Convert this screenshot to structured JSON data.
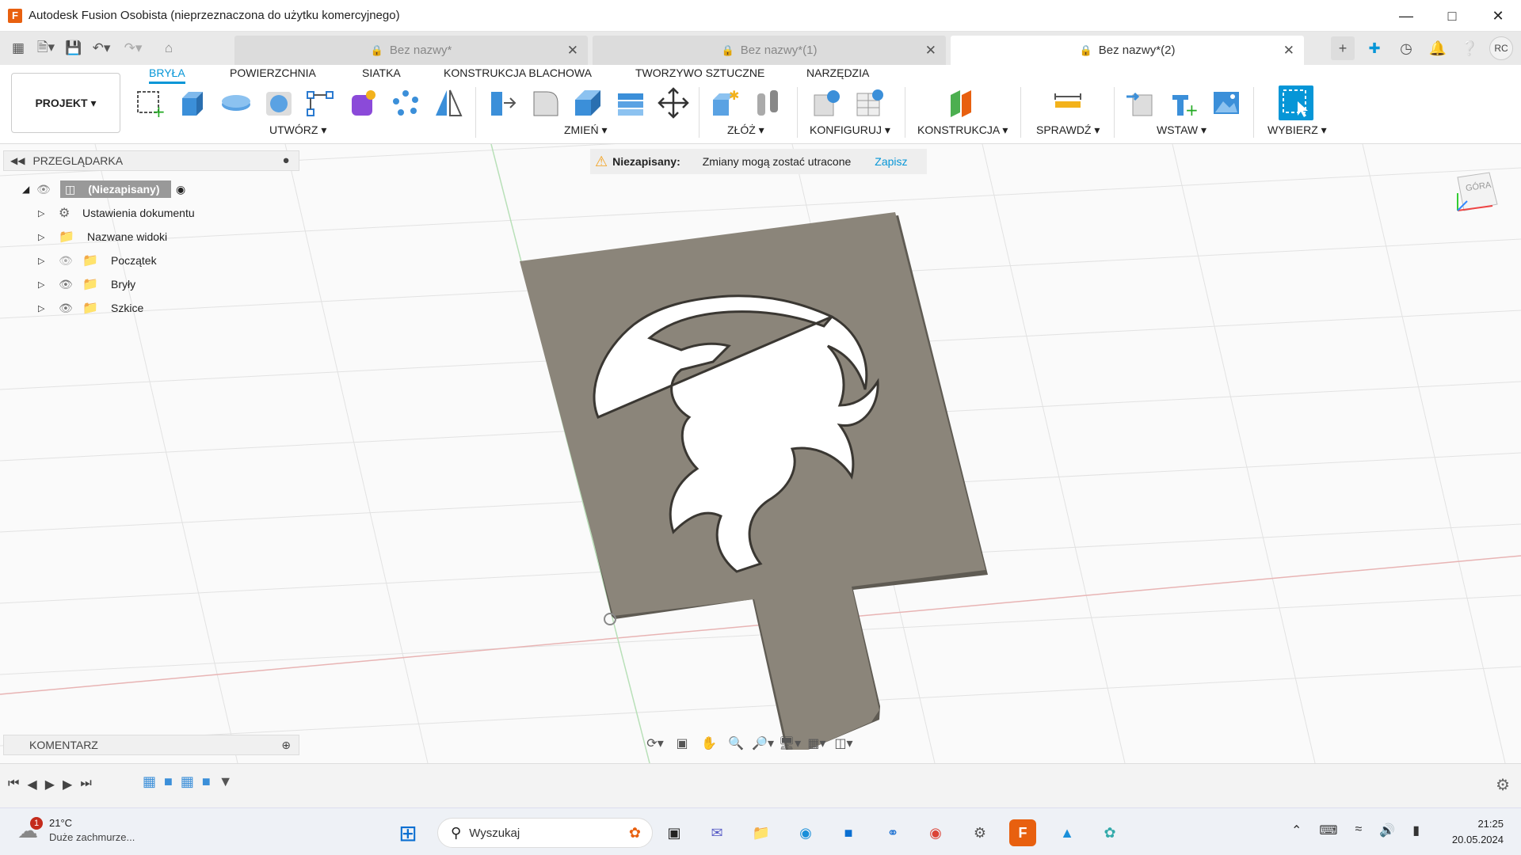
{
  "window": {
    "title": "Autodesk Fusion Osobista (nieprzeznaczona do użytku komercyjnego)",
    "app_icon": "F"
  },
  "tabs": [
    {
      "label": "Bez nazwy*",
      "active": false
    },
    {
      "label": "Bez nazwy*(1)",
      "active": false
    },
    {
      "label": "Bez nazwy*(2)",
      "active": true
    }
  ],
  "user": {
    "initials": "RC"
  },
  "ribbon": {
    "project_label": "PROJEKT",
    "tabs": [
      "BRYŁA",
      "POWIERZCHNIA",
      "SIATKA",
      "KONSTRUKCJA BLACHOWA",
      "TWORZYWO SZTUCZNE",
      "NARZĘDZIA"
    ],
    "groups": [
      "UTWÓRZ",
      "ZMIEŃ",
      "ZŁÓŻ",
      "KONFIGURUJ",
      "KONSTRUKCJA",
      "SPRAWDŹ",
      "WSTAW",
      "WYBIERZ"
    ]
  },
  "browser": {
    "title": "PRZEGLĄDARKA",
    "root": "(Niezapisany)",
    "items": [
      "Ustawienia dokumentu",
      "Nazwane widoki",
      "Początek",
      "Bryły",
      "Szkice"
    ]
  },
  "warning": {
    "label": "Niezapisany:",
    "message": "Zmiany mogą zostać utracone",
    "action": "Zapisz"
  },
  "viewcube": {
    "label": "GÓRA"
  },
  "comments": {
    "title": "KOMENTARZ"
  },
  "taskbar": {
    "weather_temp": "21°C",
    "weather_desc": "Duże zachmurze...",
    "weather_badge": "1",
    "search_placeholder": "Wyszukaj",
    "time": "21:25",
    "date": "20.05.2024"
  },
  "colors": {
    "accent": "#0696d7",
    "model": "#8b857a",
    "fusion": "#e8600f"
  }
}
